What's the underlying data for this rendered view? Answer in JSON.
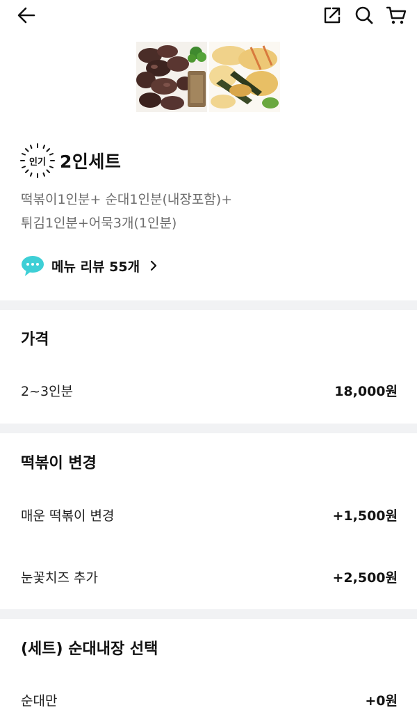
{
  "header": {
    "back_icon": "arrow-left-icon",
    "share_icon": "share-icon",
    "search_icon": "search-icon",
    "cart_icon": "cart-icon"
  },
  "menu": {
    "badge": "인기",
    "title": "2인세트",
    "description_line1": "떡볶이1인분+ 순대1인분(내장포함)+",
    "description_line2": "튀김1인분+어묵3개(1인분)",
    "review_label": "메뉴 리뷰 55개",
    "review_icon": "speech-bubble-icon"
  },
  "sections": {
    "price": {
      "title": "가격",
      "options": [
        {
          "name": "2~3인분",
          "price": "18,000원"
        }
      ]
    },
    "tteokbokki": {
      "title": "떡볶이 변경",
      "options": [
        {
          "name": "매운 떡볶이 변경",
          "price": "+1,500원"
        },
        {
          "name": "눈꽃치즈 추가",
          "price": "+2,500원"
        }
      ]
    },
    "sundae": {
      "title": "(세트) 순대내장 선택",
      "options": [
        {
          "name": "순대만",
          "price": "+0원"
        }
      ]
    }
  },
  "colors": {
    "divider": "#f1f2f4",
    "review_icon": "#3ecfd6",
    "description": "#6d6d6d"
  }
}
